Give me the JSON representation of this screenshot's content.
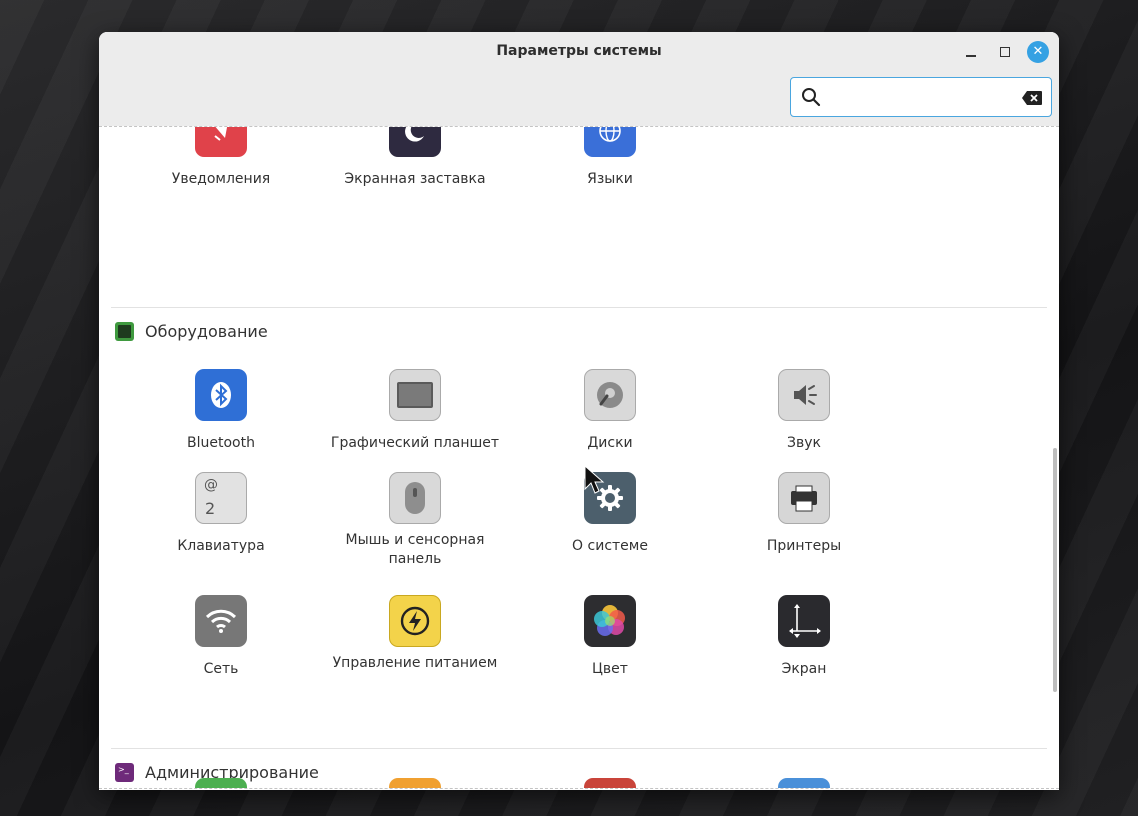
{
  "window": {
    "title": "Параметры системы"
  },
  "search": {
    "placeholder": "",
    "value": ""
  },
  "top_row": [
    {
      "label": "Уведомления",
      "icon": "notifications-icon",
      "color": "#e0424a"
    },
    {
      "label": "Экранная заставка",
      "icon": "screensaver-icon",
      "color": "#2e2a40"
    },
    {
      "label": "Языки",
      "icon": "languages-icon",
      "color": "#3a6fd8"
    }
  ],
  "sections": {
    "hardware": {
      "title": "Оборудование",
      "icon": "hardware-chip-icon",
      "color": "#3f9a3f",
      "items": [
        {
          "label": "Bluetooth",
          "icon": "bluetooth-icon",
          "color": "#2f6fd6"
        },
        {
          "label": "Графический планшет",
          "icon": "graphics-tablet-icon",
          "color": "#d9d9d9"
        },
        {
          "label": "Диски",
          "icon": "disks-icon",
          "color": "#d9d9d9"
        },
        {
          "label": "Звук",
          "icon": "sound-icon",
          "color": "#d9d9d9"
        },
        {
          "label": "Клавиатура",
          "icon": "keyboard-icon",
          "color": "#e2e2e2"
        },
        {
          "label": "Мышь и сенсорная панель",
          "icon": "mouse-icon",
          "color": "#d9d9d9"
        },
        {
          "label": "О системе",
          "icon": "system-info-gear-icon",
          "color": "#4c5f6c"
        },
        {
          "label": "Принтеры",
          "icon": "printer-icon",
          "color": "#d6d6d6"
        },
        {
          "label": "Сеть",
          "icon": "network-wifi-icon",
          "color": "#777777"
        },
        {
          "label": "Управление питанием",
          "icon": "power-management-icon",
          "color": "#f3d34a"
        },
        {
          "label": "Цвет",
          "icon": "color-icon",
          "color": "#2d2d30"
        },
        {
          "label": "Экран",
          "icon": "display-icon",
          "color": "#2a2a2e"
        }
      ]
    },
    "admin": {
      "title": "Администрирование",
      "icon": "terminal-icon",
      "color": "#6e2a7a"
    }
  }
}
